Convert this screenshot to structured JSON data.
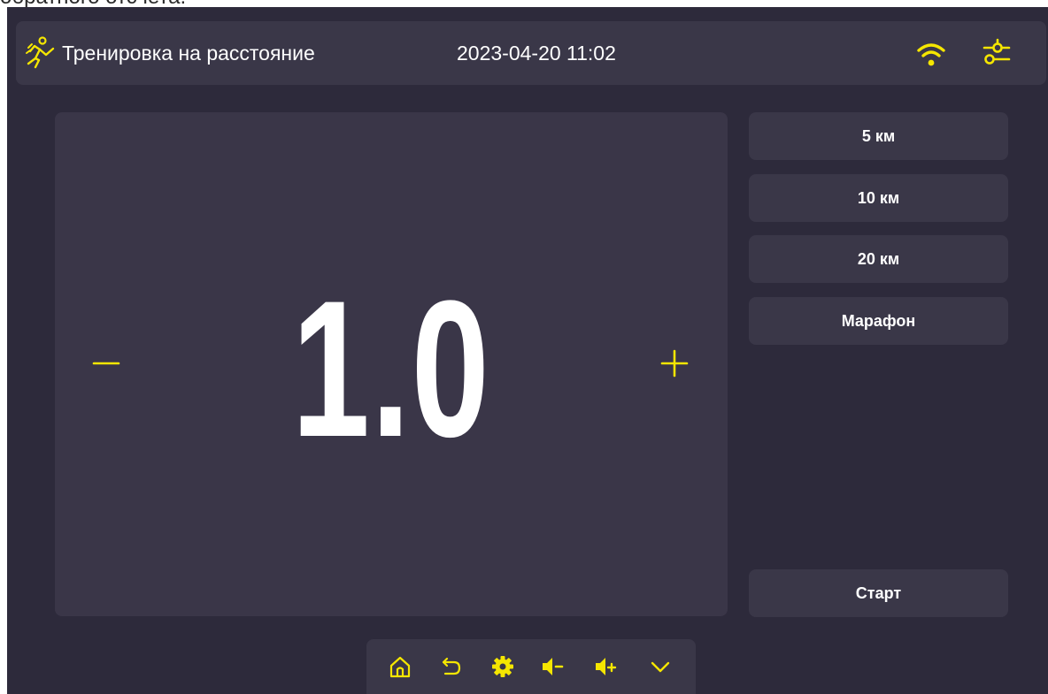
{
  "caption": {
    "text": "обратного отсчета."
  },
  "header": {
    "title": "Тренировка на расстояние",
    "datetime": "2023-04-20 11:02",
    "icons": [
      "runner-icon",
      "wifi-icon",
      "settings-sliders-icon"
    ]
  },
  "main": {
    "value": "1.0",
    "decrease_symbol": "minus-icon",
    "increase_symbol": "plus-icon"
  },
  "presets": [
    {
      "label": "5 км"
    },
    {
      "label": "10 км"
    },
    {
      "label": "20 км"
    },
    {
      "label": "Марафон"
    }
  ],
  "start": {
    "label": "Старт"
  },
  "bottom_nav": {
    "icons": [
      "home-icon",
      "back-icon",
      "gear-icon",
      "volume-down-icon",
      "volume-up-icon",
      "chevron-down-icon"
    ]
  },
  "colors": {
    "accent": "#f5e600",
    "background": "#2d2a3b",
    "panel": "#3a3748",
    "text": "#ffffff"
  }
}
